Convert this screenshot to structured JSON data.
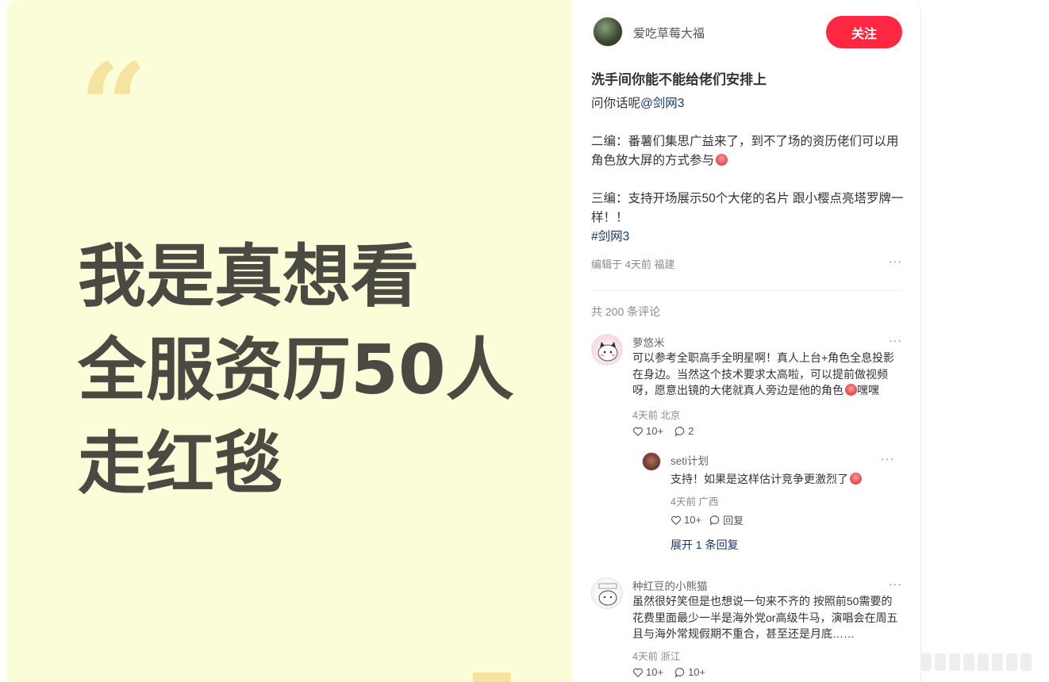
{
  "media": {
    "quote": "“",
    "headline": [
      "我是真想看",
      "全服资历50人",
      "走红毯"
    ]
  },
  "author": {
    "name": "爱吃草莓大福",
    "follow_label": "关注"
  },
  "post": {
    "title": "洗手间你能不能给佬们安排上",
    "line1_text": "问你话呢",
    "line1_mention": "@剑网3",
    "edit2": "二编：番薯们集思广益来了，到不了场的资历佬们可以用角色放大屏的方式参与",
    "edit3": "三编：支持开场展示50个大佬的名片 跟小樱点亮塔罗牌一样！！",
    "hashtag": "#剑网3",
    "meta": "编辑于 4天前 福建",
    "more": "···"
  },
  "comments_header": "共 200 条评论",
  "comments": [
    {
      "name": "萝悠米",
      "text": "可以参考全职高手全明星啊！真人上台+角色全息投影在身边。当然这个技术要求太高啦，可以提前做视频呀，愿意出镜的大佬就真人旁边是他的角色",
      "text_suffix": "嘿嘿",
      "meta": "4天前 北京",
      "likes": "10+",
      "replies": "2",
      "more": "···"
    },
    {
      "name": "种红豆的小熊猫",
      "text": "虽然很好笑但是也想说一句来不齐的 按照前50需要的花费里面最少一半是海外党or高级牛马，演唱会在周五且与海外常规假期不重合，甚至还是月底……",
      "meta": "4天前 浙江",
      "likes": "10+",
      "replies": "10+",
      "more": "···"
    }
  ],
  "reply": {
    "name": "seti计划",
    "text": "支持！如果是这样估计竞争更激烈了",
    "meta": "4天前 广西",
    "likes": "10+",
    "reply_label": "回复",
    "expand": "展开 1 条回复",
    "more": "···"
  },
  "colors": {
    "accent": "#ff2741",
    "media_bg": "#fbfdd9",
    "headline": "#4a4a42",
    "link": "#13386c"
  }
}
